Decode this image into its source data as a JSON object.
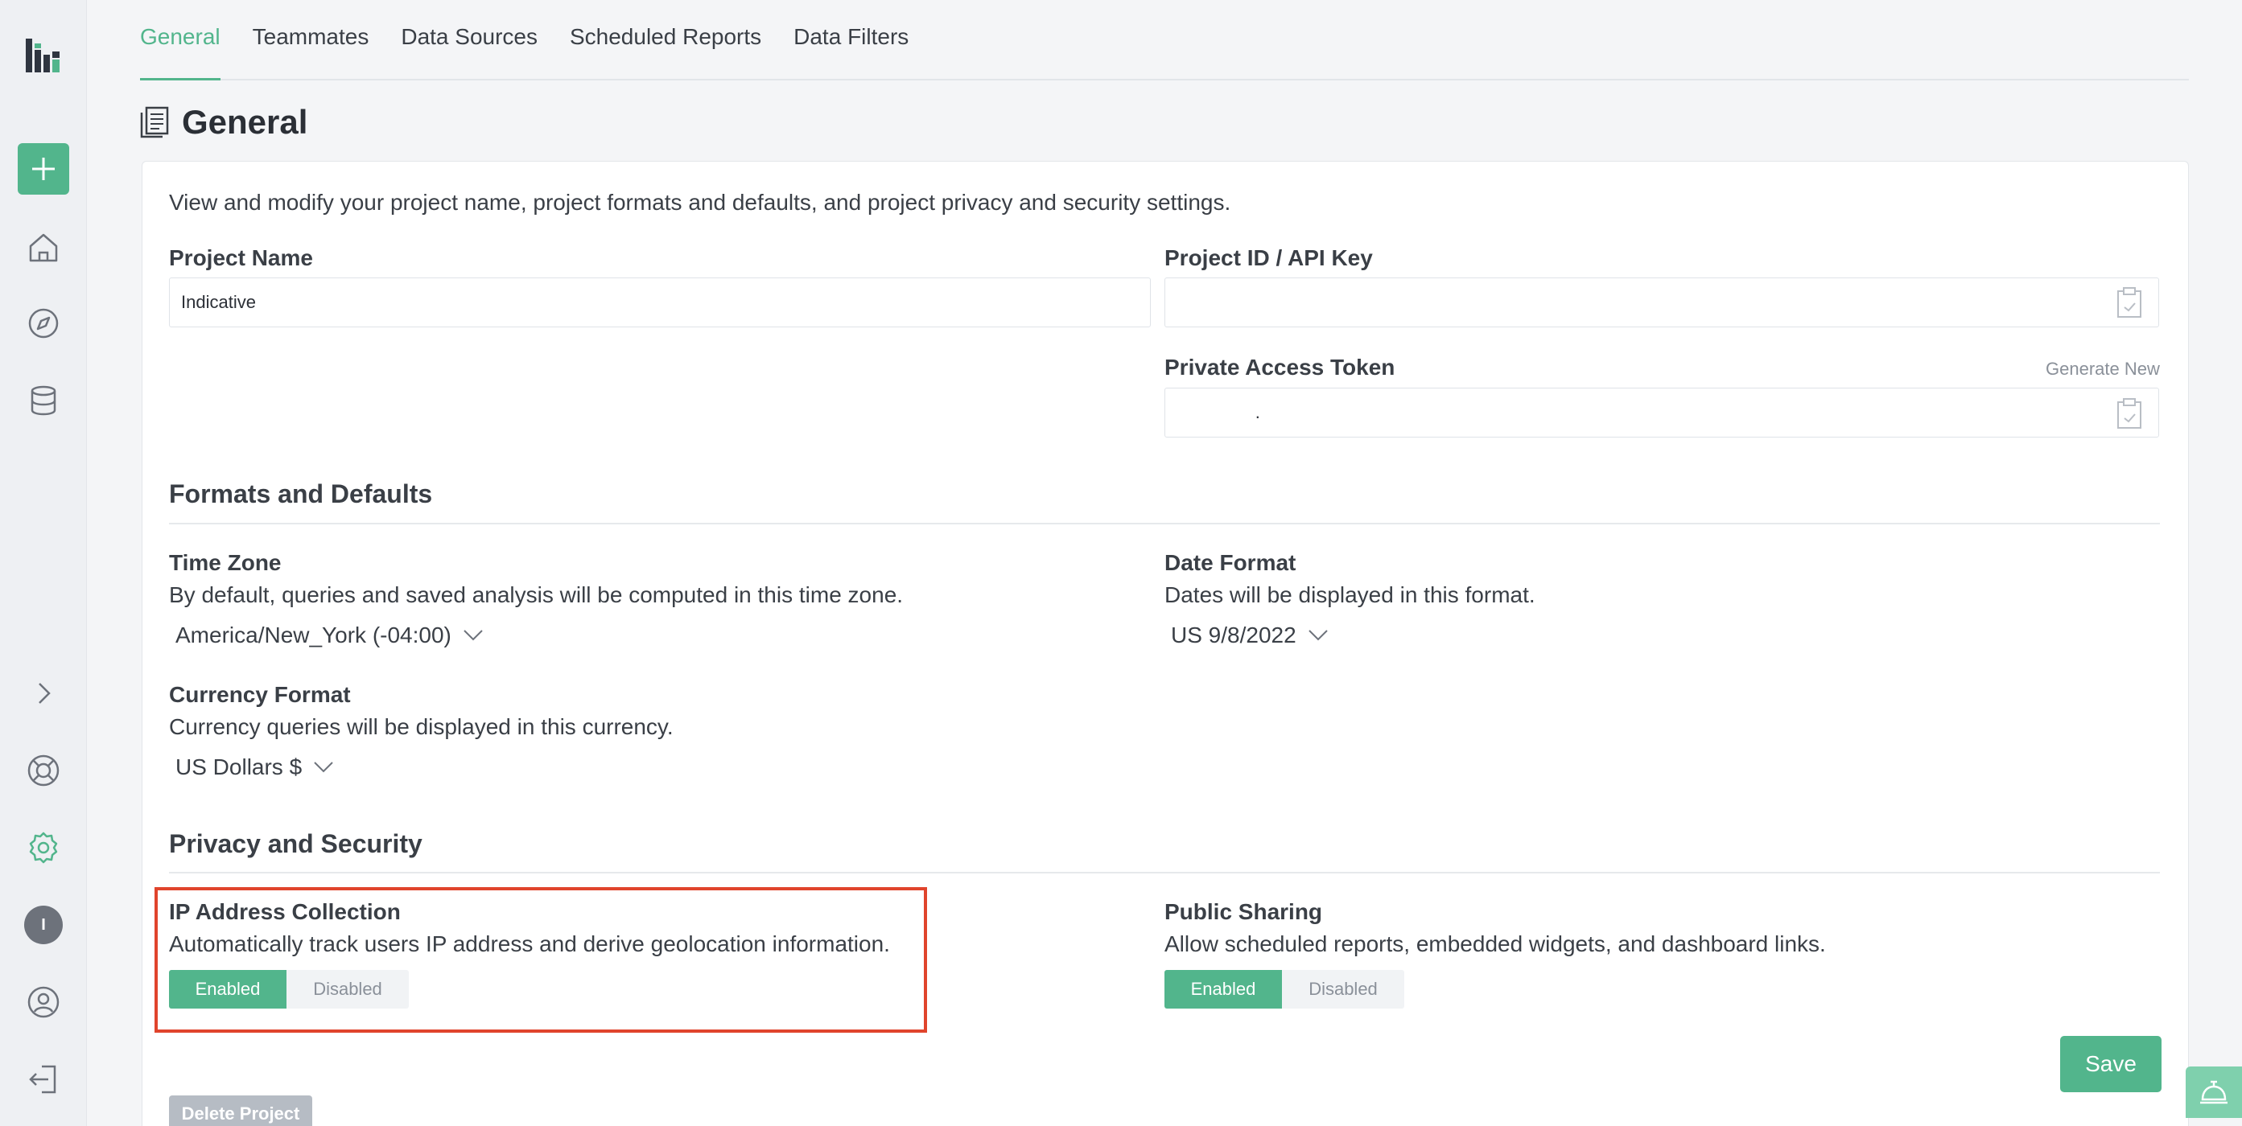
{
  "colors": {
    "accent": "#52b58c",
    "highlight": "#e0442c",
    "sidebar_bg": "#eef0f3"
  },
  "sidebar": {
    "logo": "indicative-logo-icon",
    "add_button": "plus-icon",
    "items": [
      "home-icon",
      "compass-icon",
      "database-icon"
    ],
    "expand": "chevron-right-icon",
    "bottom_items": [
      "lifebuoy-icon",
      "gear-icon",
      "avatar",
      "user-circle-icon",
      "logout-icon"
    ],
    "avatar_initial": "I"
  },
  "tabs": [
    {
      "label": "General",
      "active": true
    },
    {
      "label": "Teammates",
      "active": false
    },
    {
      "label": "Data Sources",
      "active": false
    },
    {
      "label": "Scheduled Reports",
      "active": false
    },
    {
      "label": "Data Filters",
      "active": false
    }
  ],
  "page": {
    "title": "General"
  },
  "intro": "View and modify your project name, project formats and defaults, and project privacy and security settings.",
  "project": {
    "name_label": "Project Name",
    "name_value": "Indicative",
    "id_label": "Project ID / API Key",
    "id_value": "",
    "token_label": "Private Access Token",
    "token_value": "                .",
    "generate_label": "Generate New"
  },
  "formats": {
    "heading": "Formats and Defaults",
    "timezone_label": "Time Zone",
    "timezone_desc": "By default, queries and saved analysis will be computed in this time zone.",
    "timezone_value": "America/New_York (-04:00)",
    "date_label": "Date Format",
    "date_desc": "Dates will be displayed in this format.",
    "date_value": "US 9/8/2022",
    "currency_label": "Currency Format",
    "currency_desc": "Currency queries will be displayed in this currency.",
    "currency_value": "US Dollars $"
  },
  "privacy": {
    "heading": "Privacy and Security",
    "ip_label": "IP Address Collection",
    "ip_desc": "Automatically track users IP address and derive geolocation information.",
    "sharing_label": "Public Sharing",
    "sharing_desc": "Allow scheduled reports, embedded widgets, and dashboard links.",
    "enabled": "Enabled",
    "disabled": "Disabled",
    "ip_state": "Enabled",
    "sharing_state": "Enabled"
  },
  "actions": {
    "save": "Save",
    "delete": "Delete Project"
  }
}
